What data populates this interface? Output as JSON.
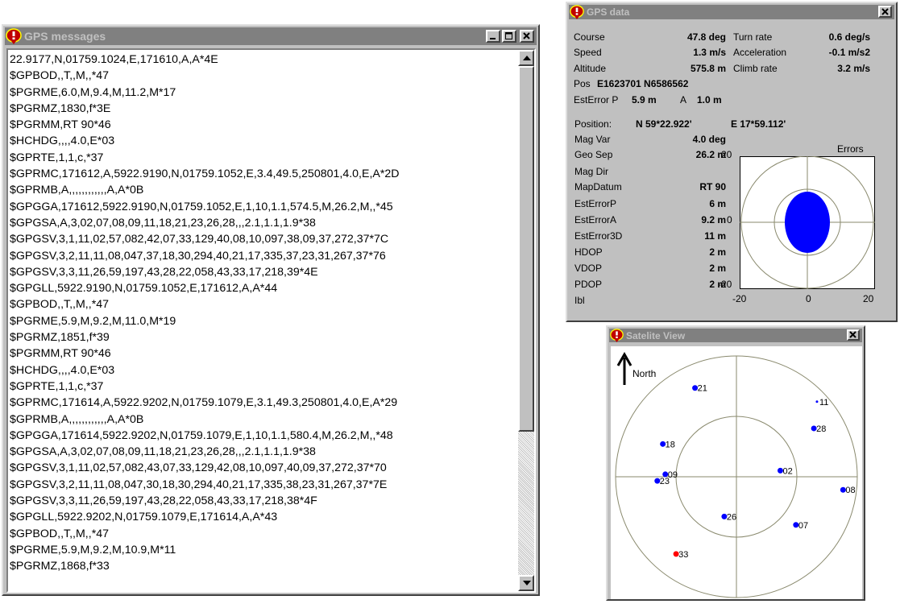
{
  "messages_window": {
    "title": "GPS messages",
    "lines": [
      "22.9177,N,01759.1024,E,171610,A,A*4E",
      "$GPBOD,,T,,M,,*47",
      "$PGRME,6.0,M,9.4,M,11.2,M*17",
      "$PGRMZ,1830,f*3E",
      "$PGRMM,RT 90*46",
      "$HCHDG,,,,4.0,E*03",
      "$GPRTE,1,1,c,*37",
      "$GPRMC,171612,A,5922.9190,N,01759.1052,E,3.4,49.5,250801,4.0,E,A*2D",
      "$GPRMB,A,,,,,,,,,,,,A,A*0B",
      "$GPGGA,171612,5922.9190,N,01759.1052,E,1,10,1.1,574.5,M,26.2,M,,*45",
      "$GPGSA,A,3,02,07,08,09,11,18,21,23,26,28,,,2.1,1.1,1.9*38",
      "$GPGSV,3,1,11,02,57,082,42,07,33,129,40,08,10,097,38,09,37,272,37*7C",
      "$GPGSV,3,2,11,11,08,047,37,18,30,294,40,21,17,335,37,23,31,267,37*76",
      "$GPGSV,3,3,11,26,59,197,43,28,22,058,43,33,17,218,39*4E",
      "$GPGLL,5922.9190,N,01759.1052,E,171612,A,A*44",
      "$GPBOD,,T,,M,,*47",
      "$PGRME,5.9,M,9.2,M,11.0,M*19",
      "$PGRMZ,1851,f*39",
      "$PGRMM,RT 90*46",
      "$HCHDG,,,,4.0,E*03",
      "$GPRTE,1,1,c,*37",
      "$GPRMC,171614,A,5922.9202,N,01759.1079,E,3.1,49.3,250801,4.0,E,A*29",
      "$GPRMB,A,,,,,,,,,,,,A,A*0B",
      "$GPGGA,171614,5922.9202,N,01759.1079,E,1,10,1.1,580.4,M,26.2,M,,*48",
      "$GPGSA,A,3,02,07,08,09,11,18,21,23,26,28,,,2.1,1.1,1.9*38",
      "$GPGSV,3,1,11,02,57,082,43,07,33,129,42,08,10,097,40,09,37,272,37*70",
      "$GPGSV,3,2,11,11,08,047,30,18,30,294,40,21,17,335,38,23,31,267,37*7E",
      "$GPGSV,3,3,11,26,59,197,43,28,22,058,43,33,17,218,38*4F",
      "$GPGLL,5922.9202,N,01759.1079,E,171614,A,A*43",
      "$GPBOD,,T,,M,,*47",
      "$PGRME,5.9,M,9.2,M,10.9,M*11",
      "$PGRMZ,1868,f*33"
    ]
  },
  "data_window": {
    "title": "GPS data",
    "course_label": "Course",
    "course_value": "47.8 deg",
    "speed_label": "Speed",
    "speed_value": "1.3 m/s",
    "altitude_label": "Altitude",
    "altitude_value": "575.8 m",
    "turnrate_label": "Turn rate",
    "turnrate_value": "0.6 deg/s",
    "accel_label": "Acceleration",
    "accel_value": "-0.1 m/s2",
    "climb_label": "Climb rate",
    "climb_value": "3.2 m/s",
    "pos_label": "Pos",
    "pos_value": "E1623701 N6586562",
    "esterrp_label": "EstError P",
    "esterrp_value": "5.9 m",
    "a_label": "A",
    "a_value": "1.0 m",
    "position_label": "Position:",
    "position_n": "N 59*22.922'",
    "position_e": "E 17*59.112'",
    "magvar_label": "Mag Var",
    "magvar_value": "4.0 deg",
    "geosep_label": "Geo Sep",
    "geosep_value": "26.2 m",
    "magdir_label": "Mag Dir",
    "mapdatum_label": "MapDatum",
    "mapdatum_value": "RT 90",
    "esterrorp_label": "EstErrorP",
    "esterrorp_value": "6 m",
    "esterrora_label": "EstErrorA",
    "esterrora_value": "9.2 m",
    "esterror3d_label": "EstError3D",
    "esterror3d_value": "11 m",
    "hdop_label": "HDOP",
    "hdop_value": "2 m",
    "vdop_label": "VDOP",
    "vdop_value": "2 m",
    "pdop_label": "PDOP",
    "pdop_value": "2 m",
    "ibl_label": "Ibl",
    "errors_title": "Errors",
    "y_top": "20",
    "y_mid": "0",
    "y_bot": "-20",
    "x_left": "-20",
    "x_mid": "0",
    "x_right": "20",
    "error_ellipse_color": "#0000ff"
  },
  "satellite_window": {
    "title": "Satelite View",
    "north_label": "North",
    "satellites": [
      {
        "id": "21",
        "color": "#0000ff"
      },
      {
        "id": "11",
        "color": "#0000ff"
      },
      {
        "id": "28",
        "color": "#0000ff"
      },
      {
        "id": "18",
        "color": "#0000ff"
      },
      {
        "id": "09",
        "color": "#0000ff"
      },
      {
        "id": "23",
        "color": "#0000ff"
      },
      {
        "id": "02",
        "color": "#0000ff"
      },
      {
        "id": "08",
        "color": "#0000ff"
      },
      {
        "id": "26",
        "color": "#0000ff"
      },
      {
        "id": "07",
        "color": "#0000ff"
      },
      {
        "id": "33",
        "color": "#ff0000"
      }
    ]
  }
}
